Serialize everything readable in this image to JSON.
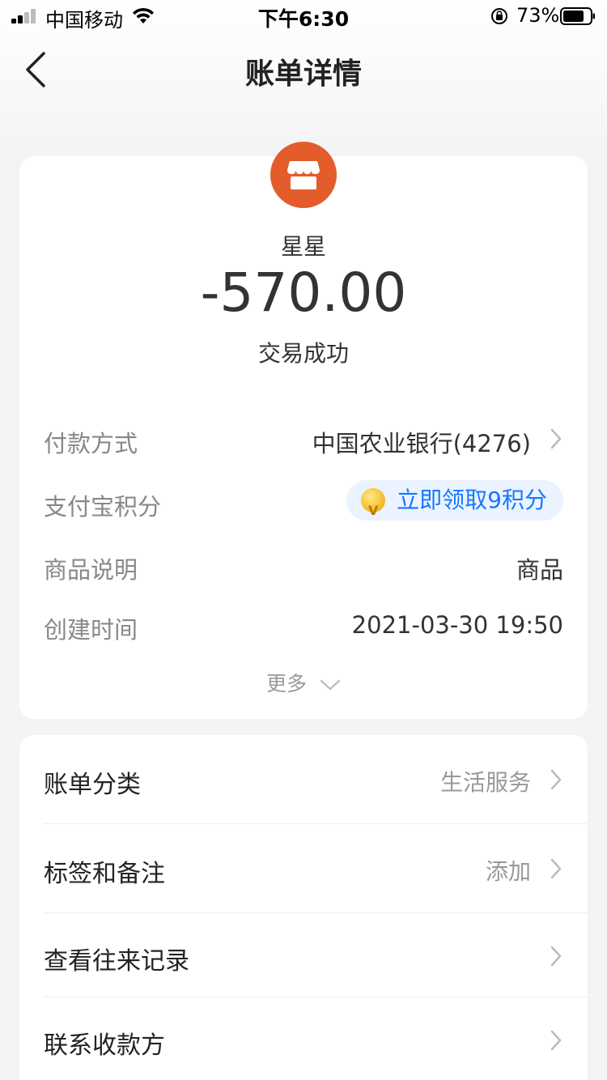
{
  "status_bar": {
    "carrier": "中国移动",
    "time": "下午6:30",
    "battery": "73%",
    "battery_level": 0.73
  },
  "nav": {
    "title": "账单详情",
    "back_icon": "chevron-left-icon"
  },
  "transaction": {
    "merchant_icon": "store-icon",
    "merchant_color": "#e35d2c",
    "merchant": "星星",
    "amount": "-570.00",
    "status": "交易成功"
  },
  "details": {
    "payment_method_label": "付款方式",
    "payment_method_value": "中国农业银行(4276)",
    "points_label": "支付宝积分",
    "points_value": "立即领取9积分",
    "product_label": "商品说明",
    "product_value": "商品",
    "created_label": "创建时间",
    "created_value": "2021-03-30 19:50",
    "more_label": "更多"
  },
  "actions": {
    "category_label": "账单分类",
    "category_value": "生活服务",
    "tags_label": "标签和备注",
    "tags_value": "添加",
    "history_label": "查看往来记录",
    "contact_label": "联系收款方"
  },
  "colors": {
    "accent_blue": "#1677ff",
    "pill_bg": "#eaf3ff"
  }
}
